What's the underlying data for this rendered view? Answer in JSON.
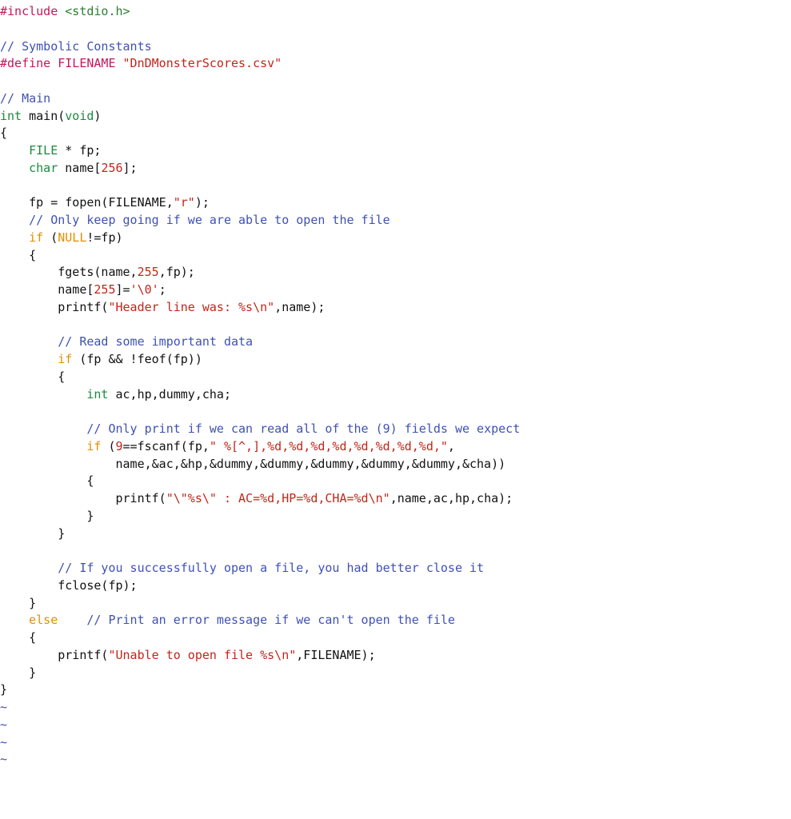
{
  "lines": [
    [
      {
        "cls": "c-preproc",
        "text": "#include "
      },
      {
        "cls": "c-libincl",
        "text": "<stdio.h>"
      }
    ],
    [],
    [
      {
        "cls": "c-comment",
        "text": "// Symbolic Constants"
      }
    ],
    [
      {
        "cls": "c-preproc",
        "text": "#define FILENAME "
      },
      {
        "cls": "c-string",
        "text": "\"DnDMonsterScores.csv\""
      }
    ],
    [],
    [
      {
        "cls": "c-comment",
        "text": "// Main"
      }
    ],
    [
      {
        "cls": "c-type",
        "text": "int"
      },
      {
        "cls": "c-default",
        "text": " main("
      },
      {
        "cls": "c-type",
        "text": "void"
      },
      {
        "cls": "c-default",
        "text": ")"
      }
    ],
    [
      {
        "cls": "c-default",
        "text": "{"
      }
    ],
    [
      {
        "cls": "c-default",
        "text": "    "
      },
      {
        "cls": "c-type",
        "text": "FILE"
      },
      {
        "cls": "c-default",
        "text": " * fp;"
      }
    ],
    [
      {
        "cls": "c-default",
        "text": "    "
      },
      {
        "cls": "c-type",
        "text": "char"
      },
      {
        "cls": "c-default",
        "text": " name["
      },
      {
        "cls": "c-number",
        "text": "256"
      },
      {
        "cls": "c-default",
        "text": "];"
      }
    ],
    [],
    [
      {
        "cls": "c-default",
        "text": "    fp = fopen(FILENAME,"
      },
      {
        "cls": "c-string",
        "text": "\"r\""
      },
      {
        "cls": "c-default",
        "text": ");"
      }
    ],
    [
      {
        "cls": "c-default",
        "text": "    "
      },
      {
        "cls": "c-comment",
        "text": "// Only keep going if we are able to open the file"
      }
    ],
    [
      {
        "cls": "c-default",
        "text": "    "
      },
      {
        "cls": "c-keyword",
        "text": "if"
      },
      {
        "cls": "c-default",
        "text": " ("
      },
      {
        "cls": "c-keyword",
        "text": "NULL"
      },
      {
        "cls": "c-default",
        "text": "!=fp)"
      }
    ],
    [
      {
        "cls": "c-default",
        "text": "    {"
      }
    ],
    [
      {
        "cls": "c-default",
        "text": "        fgets(name,"
      },
      {
        "cls": "c-number",
        "text": "255"
      },
      {
        "cls": "c-default",
        "text": ",fp);"
      }
    ],
    [
      {
        "cls": "c-default",
        "text": "        name["
      },
      {
        "cls": "c-number",
        "text": "255"
      },
      {
        "cls": "c-default",
        "text": "]="
      },
      {
        "cls": "c-char",
        "text": "'\\0'"
      },
      {
        "cls": "c-default",
        "text": ";"
      }
    ],
    [
      {
        "cls": "c-default",
        "text": "        printf("
      },
      {
        "cls": "c-string",
        "text": "\"Header line was: %s\\n\""
      },
      {
        "cls": "c-default",
        "text": ",name);"
      }
    ],
    [],
    [
      {
        "cls": "c-default",
        "text": "        "
      },
      {
        "cls": "c-comment",
        "text": "// Read some important data"
      }
    ],
    [
      {
        "cls": "c-default",
        "text": "        "
      },
      {
        "cls": "c-keyword",
        "text": "if"
      },
      {
        "cls": "c-default",
        "text": " (fp && !feof(fp))"
      }
    ],
    [
      {
        "cls": "c-default",
        "text": "        {"
      }
    ],
    [
      {
        "cls": "c-default",
        "text": "            "
      },
      {
        "cls": "c-type",
        "text": "int"
      },
      {
        "cls": "c-default",
        "text": " ac,hp,dummy,cha;"
      }
    ],
    [],
    [
      {
        "cls": "c-default",
        "text": "            "
      },
      {
        "cls": "c-comment",
        "text": "// Only print if we can read all of the (9) fields we expect"
      }
    ],
    [
      {
        "cls": "c-default",
        "text": "            "
      },
      {
        "cls": "c-keyword",
        "text": "if"
      },
      {
        "cls": "c-default",
        "text": " ("
      },
      {
        "cls": "c-number",
        "text": "9"
      },
      {
        "cls": "c-default",
        "text": "==fscanf(fp,"
      },
      {
        "cls": "c-string",
        "text": "\" %[^,],%d,%d,%d,%d,%d,%d,%d,%d,\""
      },
      {
        "cls": "c-default",
        "text": ","
      }
    ],
    [
      {
        "cls": "c-default",
        "text": "                name,&ac,&hp,&dummy,&dummy,&dummy,&dummy,&dummy,&cha))"
      }
    ],
    [
      {
        "cls": "c-default",
        "text": "            {"
      }
    ],
    [
      {
        "cls": "c-default",
        "text": "                printf("
      },
      {
        "cls": "c-string",
        "text": "\"\\\"%s\\\" : AC=%d,HP=%d,CHA=%d\\n\""
      },
      {
        "cls": "c-default",
        "text": ",name,ac,hp,cha);"
      }
    ],
    [
      {
        "cls": "c-default",
        "text": "            }"
      }
    ],
    [
      {
        "cls": "c-default",
        "text": "        }"
      }
    ],
    [],
    [
      {
        "cls": "c-default",
        "text": "        "
      },
      {
        "cls": "c-comment",
        "text": "// If you successfully open a file, you had better close it"
      }
    ],
    [
      {
        "cls": "c-default",
        "text": "        fclose(fp);"
      }
    ],
    [
      {
        "cls": "c-default",
        "text": "    }"
      }
    ],
    [
      {
        "cls": "c-default",
        "text": "    "
      },
      {
        "cls": "c-keyword",
        "text": "else"
      },
      {
        "cls": "c-default",
        "text": "    "
      },
      {
        "cls": "c-comment",
        "text": "// Print an error message if we can't open the file"
      }
    ],
    [
      {
        "cls": "c-default",
        "text": "    {"
      }
    ],
    [
      {
        "cls": "c-default",
        "text": "        printf("
      },
      {
        "cls": "c-string",
        "text": "\"Unable to open file %s\\n\""
      },
      {
        "cls": "c-default",
        "text": ",FILENAME);"
      }
    ],
    [
      {
        "cls": "c-default",
        "text": "    }"
      }
    ],
    [
      {
        "cls": "c-default",
        "text": "}"
      }
    ],
    [
      {
        "cls": "c-tilde",
        "text": "~"
      }
    ],
    [
      {
        "cls": "c-tilde",
        "text": "~"
      }
    ],
    [
      {
        "cls": "c-tilde",
        "text": "~"
      }
    ],
    [
      {
        "cls": "c-tilde",
        "text": "~"
      }
    ]
  ]
}
